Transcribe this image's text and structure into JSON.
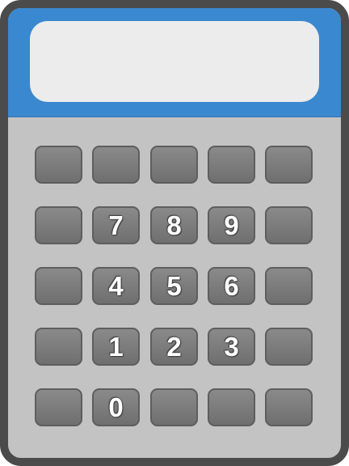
{
  "calculator": {
    "display_value": "",
    "colors": {
      "frame": "#4b4b4b",
      "body": "#c3c3c3",
      "top_panel": "#3a88cf",
      "display": "#ececec",
      "key": "#7c7c7c",
      "key_text": "#ffffff"
    },
    "keys": {
      "r1c1": "",
      "r1c2": "",
      "r1c3": "",
      "r1c4": "",
      "r1c5": "",
      "r2c1": "",
      "r2c2": "7",
      "r2c3": "8",
      "r2c4": "9",
      "r2c5": "",
      "r3c1": "",
      "r3c2": "4",
      "r3c3": "5",
      "r3c4": "6",
      "r3c5": "",
      "r4c1": "",
      "r4c2": "1",
      "r4c3": "2",
      "r4c4": "3",
      "r4c5": "",
      "r5c1": "",
      "r5c2": "0",
      "r5c3": "",
      "r5c4": "",
      "r5c5": ""
    }
  }
}
